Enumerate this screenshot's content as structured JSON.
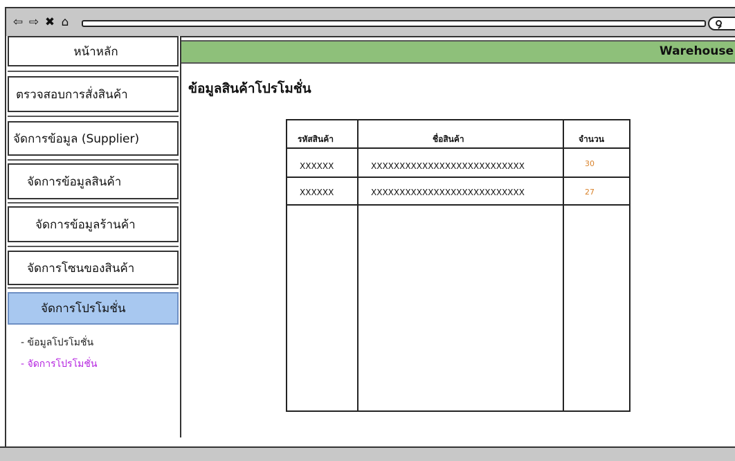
{
  "browser": {
    "back_icon": "⇦",
    "forward_icon": "⇨",
    "close_icon": "✖",
    "home_icon": "⌂"
  },
  "sidebar": {
    "items": [
      {
        "label": "หน้าหลัก"
      },
      {
        "label": "ตรวจสอบการสั่งสินค้า"
      },
      {
        "label": "จัดการข้อมูล (Supplier)"
      },
      {
        "label": "จัดการข้อมูลสินค้า"
      },
      {
        "label": "จัดการข้อมูลร้านค้า"
      },
      {
        "label": "จัดการโซนของสินค้า"
      },
      {
        "label": "จัดการโปรโมชั่น"
      }
    ],
    "sub_items": [
      {
        "label": "- ข้อมูลโปรโมชั่น"
      },
      {
        "label": "- จัดการโปรโมชั่น"
      }
    ]
  },
  "header": {
    "title": "Warehouse"
  },
  "main": {
    "title": "ข้อมูลสินค้าโปรโมชั่น",
    "table": {
      "columns": [
        "รหัสสินค้า",
        "ชื่อสินค้า",
        "จำนวน"
      ],
      "rows": [
        {
          "code": "XXXXXX",
          "name": "XXXXXXXXXXXXXXXXXXXXXXXXXXX",
          "qty": "30"
        },
        {
          "code": "XXXXXX",
          "name": "XXXXXXXXXXXXXXXXXXXXXXXXXXX",
          "qty": "27"
        }
      ]
    }
  },
  "colors": {
    "banner": "#8ec07a",
    "active_menu": "#a8c8f0",
    "current_submenu": "#b524e0",
    "quantity": "#d9822b"
  }
}
